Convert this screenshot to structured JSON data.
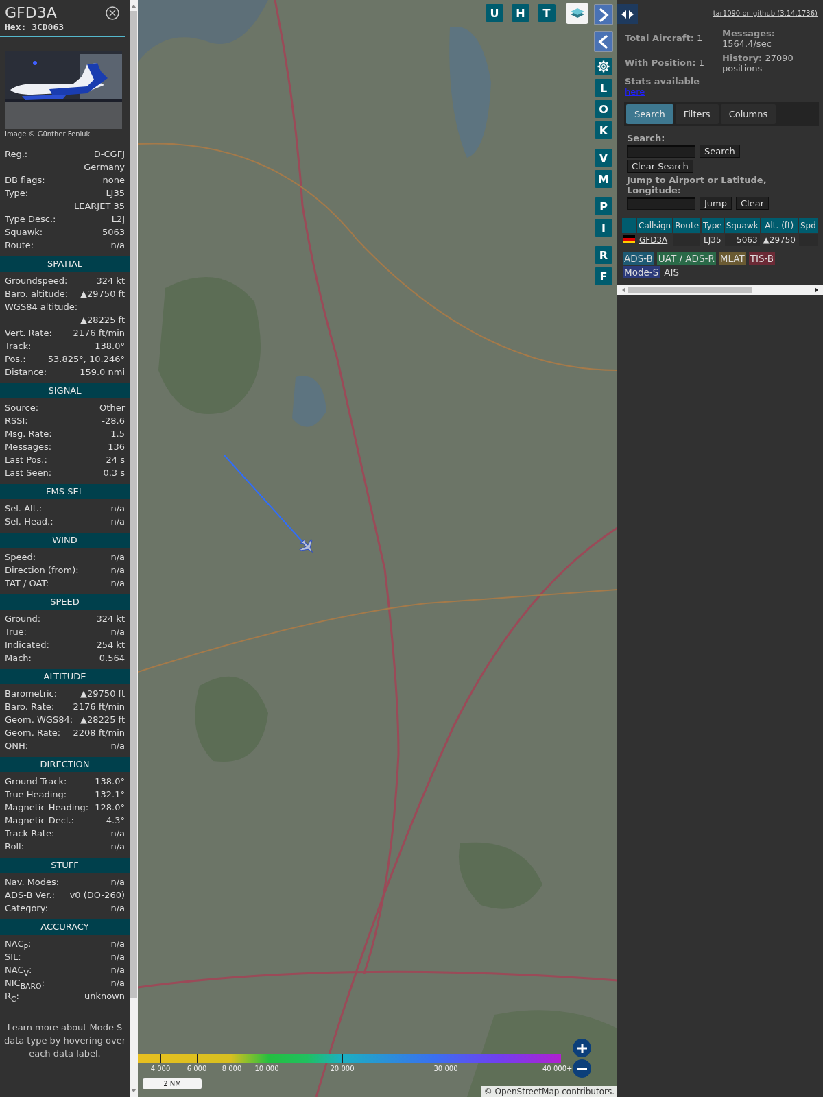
{
  "aircraft": {
    "callsign": "GFD3A",
    "hex": "Hex: 3CD063",
    "photo_credit": "Image © Günther Feniuk",
    "details": [
      {
        "label": "Reg.:",
        "value": "D-CGFJ",
        "link": true
      },
      {
        "value": "Germany"
      },
      {
        "label": "DB flags:",
        "value": "none"
      },
      {
        "label": "Type:",
        "value": "LJ35"
      },
      {
        "value": "LEARJET 35"
      },
      {
        "label": "Type Desc.:",
        "value": "L2J"
      },
      {
        "label": "Squawk:",
        "value": "5063"
      },
      {
        "label": "Route:",
        "value": "n/a"
      }
    ]
  },
  "sections": [
    {
      "title": "SPATIAL",
      "rows": [
        {
          "label": "Groundspeed:",
          "value": "324 kt"
        },
        {
          "label": "Baro. altitude:",
          "value": "▲29750 ft"
        },
        {
          "label": "WGS84 altitude:"
        },
        {
          "value": "▲28225 ft"
        },
        {
          "label": "Vert. Rate:",
          "value": "2176 ft/min"
        },
        {
          "label": "Track:",
          "value": "138.0°"
        },
        {
          "label": "Pos.:",
          "value": "53.825°, 10.246°"
        },
        {
          "label": "Distance:",
          "value": "159.0 nmi"
        }
      ]
    },
    {
      "title": "SIGNAL",
      "rows": [
        {
          "label": "Source:",
          "value": "Other"
        },
        {
          "label": "RSSI:",
          "value": "-28.6"
        },
        {
          "label": "Msg. Rate:",
          "value": "1.5"
        },
        {
          "label": "Messages:",
          "value": "136"
        },
        {
          "label": "Last Pos.:",
          "value": "24 s"
        },
        {
          "label": "Last Seen:",
          "value": "0.3 s"
        }
      ]
    },
    {
      "title": "FMS SEL",
      "rows": [
        {
          "label": "Sel. Alt.:",
          "value": "n/a"
        },
        {
          "label": "Sel. Head.:",
          "value": "n/a"
        }
      ]
    },
    {
      "title": "WIND",
      "rows": [
        {
          "label": "Speed:",
          "value": "n/a"
        },
        {
          "label": "Direction (from):",
          "value": "n/a"
        },
        {
          "label": "TAT / OAT:",
          "value": "n/a"
        }
      ]
    },
    {
      "title": "SPEED",
      "rows": [
        {
          "label": "Ground:",
          "value": "324 kt"
        },
        {
          "label": "True:",
          "value": "n/a"
        },
        {
          "label": "Indicated:",
          "value": "254 kt"
        },
        {
          "label": "Mach:",
          "value": "0.564"
        }
      ]
    },
    {
      "title": "ALTITUDE",
      "rows": [
        {
          "label": "Barometric:",
          "value": "▲29750 ft"
        },
        {
          "label": "Baro. Rate:",
          "value": "2176 ft/min"
        },
        {
          "label": "Geom. WGS84:",
          "value": "▲28225 ft"
        },
        {
          "label": "Geom. Rate:",
          "value": "2208 ft/min"
        },
        {
          "label": "QNH:",
          "value": "n/a"
        }
      ]
    },
    {
      "title": "DIRECTION",
      "rows": [
        {
          "label": "Ground Track:",
          "value": "138.0°"
        },
        {
          "label": "True Heading:",
          "value": "132.1°"
        },
        {
          "label": "Magnetic Heading:",
          "value": "128.0°"
        },
        {
          "label": "Magnetic Decl.:",
          "value": "4.3°"
        },
        {
          "label": "Track Rate:",
          "value": "n/a"
        },
        {
          "label": "Roll:",
          "value": "n/a"
        }
      ]
    },
    {
      "title": "STUFF",
      "rows": [
        {
          "label": "Nav. Modes:",
          "value": "n/a"
        },
        {
          "label": "ADS-B Ver.:",
          "value": "v0 (DO-260)"
        },
        {
          "label": "Category:",
          "value": "n/a"
        }
      ]
    },
    {
      "title": "ACCURACY",
      "rows": [
        {
          "label": "NAC$_{P}$:",
          "value": "n/a"
        },
        {
          "label": "SIL:",
          "value": "n/a"
        },
        {
          "label": "NAC$_{V}$:",
          "value": "n/a"
        },
        {
          "label": "NIC$_{BARO}$:",
          "value": "n/a"
        },
        {
          "label": "R$_{C}$:",
          "value": "unknown"
        }
      ]
    }
  ],
  "footer_note": "Learn more about Mode S data type by hovering over each data label.",
  "map": {
    "top_buttons": [
      "U",
      "H",
      "T"
    ],
    "side_button_groups": [
      [
        "L",
        "O",
        "K"
      ],
      [
        "V",
        "M"
      ],
      [
        "P",
        "I"
      ],
      [
        "R",
        "F"
      ]
    ],
    "altitude_legend": [
      "4 000",
      "6 000",
      "8 000",
      "10 000",
      "20 000",
      "30 000",
      "40 000+"
    ],
    "scale": "2 NM",
    "attribution": {
      "prefix": "© ",
      "link": "OpenStreetMap",
      "suffix": " contributors."
    }
  },
  "panel": {
    "version_link": "tar1090 on github (3.14.1736)",
    "stats": [
      {
        "label": "Total Aircraft:",
        "value": "1"
      },
      {
        "label": "Messages:",
        "value": "1564.4/sec"
      },
      {
        "label": "With Position:",
        "value": "1"
      },
      {
        "label": "History:",
        "value": "27090 positions"
      }
    ],
    "stats_note": "Stats available",
    "stats_link": "here",
    "tabs": [
      {
        "label": "Search",
        "selected": true
      },
      {
        "label": "Filters",
        "selected": false
      },
      {
        "label": "Columns",
        "selected": false
      }
    ],
    "search_label": "Search:",
    "search_button": "Search",
    "clear_search_button": "Clear Search",
    "jump_label": "Jump to Airport or Latitude, Longitude:",
    "jump_button": "Jump",
    "clear_button": "Clear",
    "table": {
      "columns": [
        "Callsign",
        "Route",
        "Type",
        "Squawk",
        "Alt. (ft)",
        "Spd"
      ],
      "rows": [
        {
          "callsign": "GFD3A",
          "route": "",
          "type": "LJ35",
          "squawk": "5063",
          "altitude": "▲29750"
        }
      ]
    },
    "legend": [
      {
        "label": "ADS-B",
        "color": "#1e5a74"
      },
      {
        "label": "UAT / ADS-R",
        "color": "#2a6a48"
      },
      {
        "label": "MLAT",
        "color": "#6a5a32"
      },
      {
        "label": "TIS-B",
        "color": "#6c2a36"
      },
      {
        "label": "Mode-S",
        "color": "#2c3a7a"
      },
      {
        "label": "AIS"
      }
    ]
  }
}
